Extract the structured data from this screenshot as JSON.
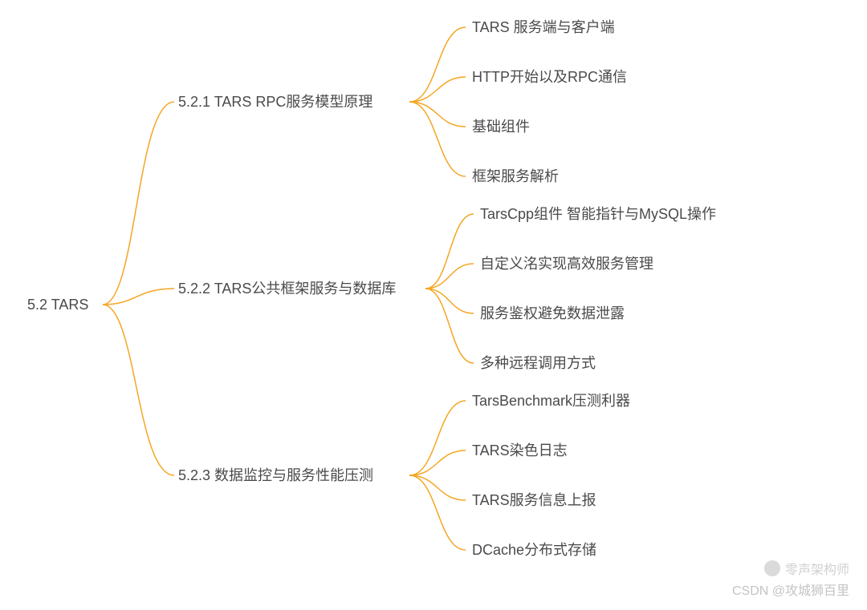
{
  "root": {
    "label": "5.2 TARS"
  },
  "branches": [
    {
      "label": "5.2.1 TARS RPC服务模型原理",
      "leaves": [
        "TARS 服务端与客户端",
        "HTTP开始以及RPC通信",
        "基础组件",
        "框架服务解析"
      ]
    },
    {
      "label": "5.2.2 TARS公共框架服务与数据库",
      "leaves": [
        "TarsCpp组件  智能指针与MySQL操作",
        "自定义洺实现高效服务管理",
        "服务鉴权避免数据泄露",
        "多种远程调用方式"
      ]
    },
    {
      "label": "5.2.3 数据监控与服务性能压测",
      "leaves": [
        "TarsBenchmark压测利器",
        "TARS染色日志",
        "TARS服务信息上报",
        "DCache分布式存储"
      ]
    }
  ],
  "watermark_primary": "零声架构师",
  "watermark_secondary": "CSDN @攻城狮百里"
}
